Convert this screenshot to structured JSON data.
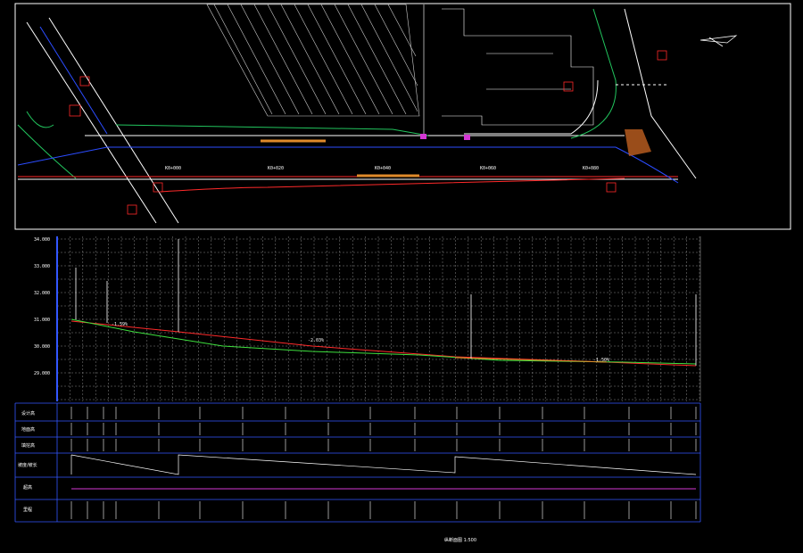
{
  "colors": {
    "background": "#000000",
    "frame": "#ffffff",
    "grid": "#8a8a8a",
    "road_edge": "#ffffff",
    "curb_green": "#22c55e",
    "centerline_blue": "#2b4cff",
    "design_red": "#ff2a2a",
    "ground_green": "#3ee03e",
    "table_blue": "#3357ff",
    "magenta": "#d437d4",
    "orange": "#e08a2a"
  },
  "plan": {
    "stations": [
      "K0+000",
      "K0+020",
      "K0+040",
      "K0+060",
      "K0+080"
    ],
    "north_label": "N"
  },
  "profile": {
    "elevations": [
      "34.000",
      "33.000",
      "32.000",
      "31.000",
      "30.000",
      "29.000"
    ],
    "grades": [
      "-1.59%",
      "-2.03%",
      "-1.50%"
    ],
    "table_rows": [
      "设计高",
      "地面高",
      "填挖高",
      "坡度/坡长",
      "超高",
      "里程"
    ],
    "footer_title": "纵断面图 1:500"
  }
}
